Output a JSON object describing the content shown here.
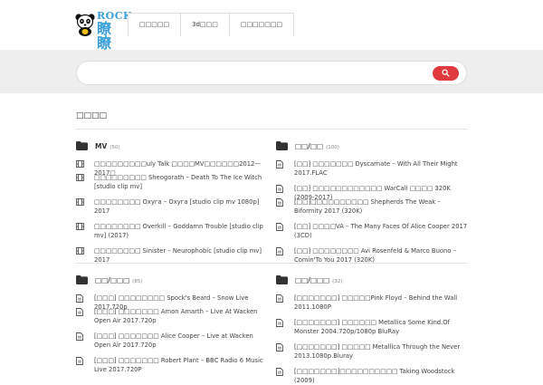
{
  "header": {
    "logo_latin": "ROCK",
    "logo_cn": "瞭瞭",
    "nav": [
      "□□□□□",
      "3d□□□",
      "□□□□□□□"
    ]
  },
  "search": {
    "value": "",
    "placeholder": ""
  },
  "page_title": "□□□□",
  "categories": [
    {
      "name": "MV",
      "count": "(50)",
      "item_icon": "film-icon",
      "items": [
        "□□□□□□□□□uly Talk □□□□MV□□□□□□2012—2017□",
        "□□□□□□□□□ Sheogorath – Death To The Ice Witch [studio clip mv]",
        "□□□□□□□□ Охуга – Охуга [studio clip mv 1080p] 2017",
        "□□□□□□□□ Overkill – Goddamn Trouble [studio clip mv] (2017)",
        "□□□□□□□□ Sinister – Neurophobic [studio clip mv] 2017"
      ]
    },
    {
      "name": "□□/□□",
      "count": "(100)",
      "item_icon": "file-icon",
      "items": [
        "[□□] □□□□□□□ Dyscarnate – With All Their Might 2017.FLAC",
        "[□□] □□□□□□□□□□□□ WarCall □□□□ 320K (2009-2017)",
        "[□□]□□□□□□□□□□ Shepherds The Weak – Biformity 2017 (320K)",
        "[□□] □□□□VA – The Many Faces Of Alice Cooper 2017 (3CD)",
        "[□□] □□□□□□□□ Avi Rosenfeld & Marco Buono – Comin'To You 2017 (320K)"
      ]
    },
    {
      "name": "□□/□□□",
      "count": "(85)",
      "item_icon": "file-icon",
      "items": [
        "[□□□] □□□□□□□□ Spock's Beard – Snow Live 2017.720p",
        "[□□□] □□□□□□□ Amon Amarth – Live At Wacken Open Air 2017.720p",
        "[□□□] □□□□□□□ Alice Cooper – Live at Wacken Open Air 2017.720p",
        "[□□□] □□□□□□□ Robert Plant – BBC Radio 6 Music Live 2017.720P"
      ]
    },
    {
      "name": "□□/□□□",
      "count": "(32)",
      "item_icon": "file-icon",
      "items": [
        "[□□□□□□□] □□□□□Pink Floyd – Behind the Wall 2011.1080P",
        "[□□□□□□□] □□□□□□ Metallica Some Kind.Of Monster 2004.720p/1080p BluRay",
        "[□□□□□□□] □□□□□ Metallica Through the Never 2013.1080p.Bluray",
        "[□□□□□□□]□□□□□□□□□□ Taking Woodstock (2009)"
      ]
    }
  ],
  "colors": {
    "accent": "#e03a3e",
    "logo": "#3a9fd6",
    "band": "#eeeeee"
  }
}
